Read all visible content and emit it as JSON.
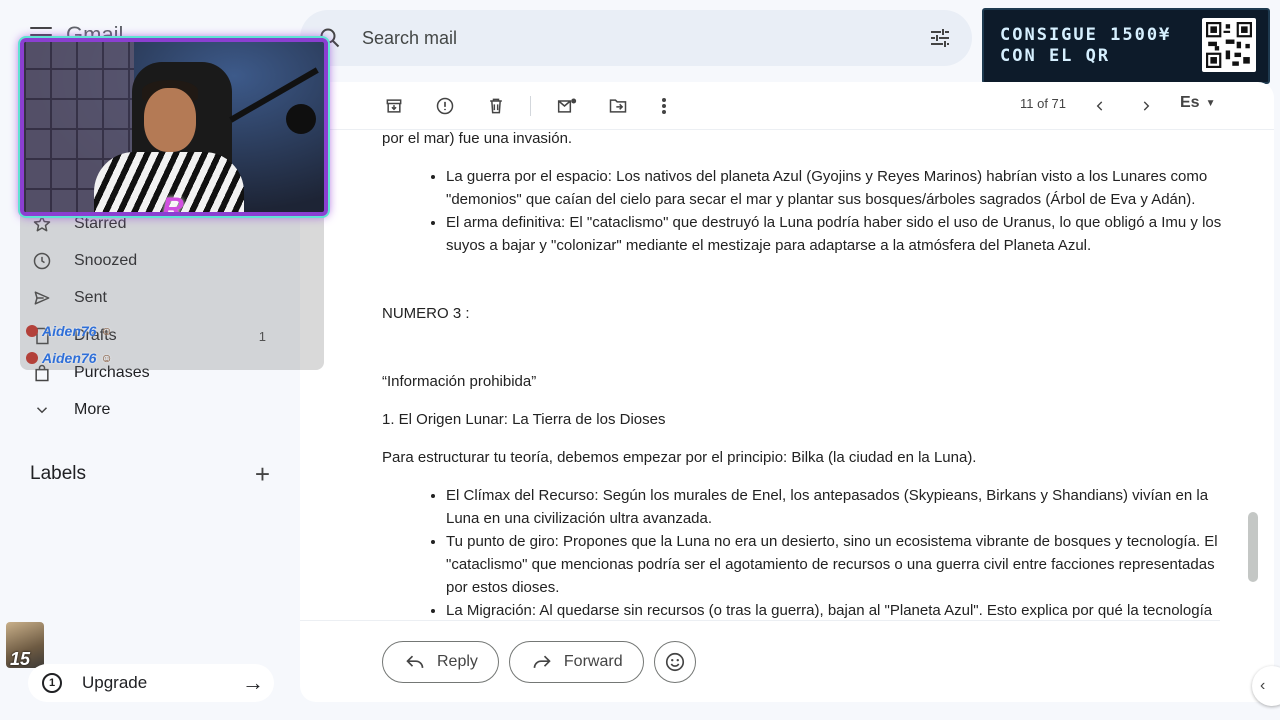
{
  "app": {
    "brand": "Gmail"
  },
  "search": {
    "placeholder": "Search mail"
  },
  "promo": {
    "text": "CONSIGUE 1500¥\nCON EL QR"
  },
  "sidebar": {
    "items": [
      {
        "label": "Starred",
        "icon": "star-icon",
        "count": ""
      },
      {
        "label": "Snoozed",
        "icon": "clock-icon",
        "count": ""
      },
      {
        "label": "Sent",
        "icon": "send-icon",
        "count": ""
      },
      {
        "label": "Drafts",
        "icon": "draft-icon",
        "count": "1"
      },
      {
        "label": "Purchases",
        "icon": "bag-icon",
        "count": ""
      },
      {
        "label": "More",
        "icon": "chevron-down-icon",
        "count": ""
      }
    ],
    "labels_title": "Labels",
    "upgrade_label": "Upgrade"
  },
  "chat": {
    "user1": "Aiden76",
    "user2": "Aiden76"
  },
  "avatar": {
    "level": "15"
  },
  "toolbar": {
    "pager": "11 of 71",
    "language": "Es"
  },
  "email": {
    "intro": "por el mar) fue una invasión.",
    "list1": [
      "La guerra por el espacio: Los nativos del planeta Azul (Gyojins y Reyes Marinos) habrían visto a los Lunares como \"demonios\" que caían del cielo para secar el mar y plantar sus bosques/árboles sagrados (Árbol de Eva y Adán).",
      "El arma definitiva: El \"cataclismo\" que destruyó la Luna podría haber sido el uso de Uranus, lo que obligó a Imu y los suyos a bajar y \"colonizar\" mediante el mestizaje para adaptarse a la atmósfera del Planeta Azul."
    ],
    "heading": "NUMERO 3 :",
    "quote": "“Información prohibida”",
    "section": "1. El Origen Lunar: La Tierra de los Dioses",
    "para": "Para estructurar tu teoría, debemos empezar por el principio: Bilka (la ciudad en la Luna).",
    "list2": [
      "El Clímax del Recurso: Según los murales de Enel, los antepasados (Skypieans, Birkans y Shandians) vivían en la Luna en una civilización ultra avanzada.",
      "Tu punto de giro: Propones que la Luna no era un desierto, sino un ecosistema vibrante de bosques y tecnología. El \"cataclismo\" que mencionas podría ser el agotamiento de recursos o una guerra civil entre facciones representadas por estos dioses.",
      "La Migración: Al quedarse sin recursos (o tras la guerra), bajan al \"Planeta Azul\". Esto explica por qué la tecnología del Siglo Vacío parece \"del futuro\"."
    ]
  },
  "actions": {
    "reply": "Reply",
    "forward": "Forward"
  }
}
